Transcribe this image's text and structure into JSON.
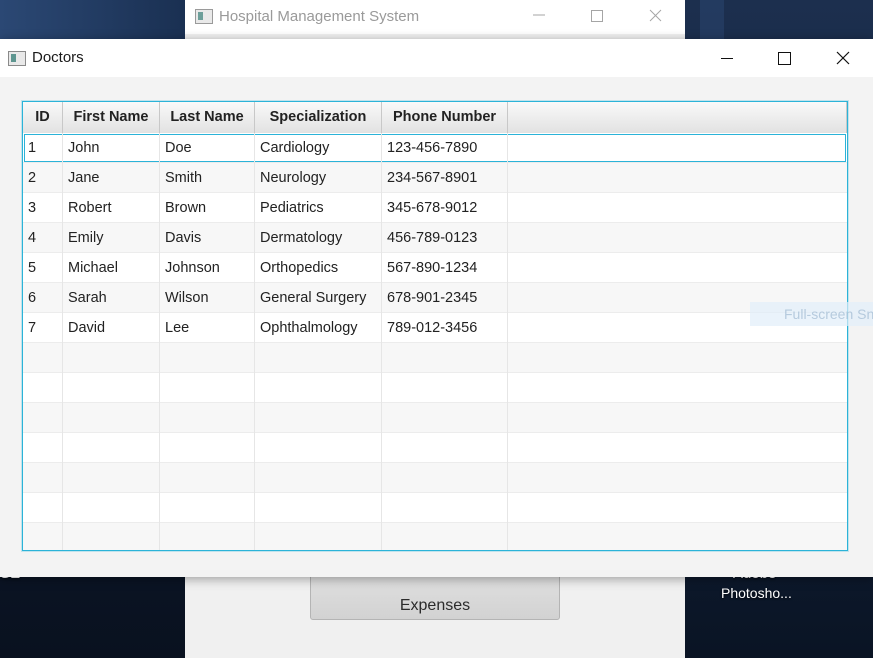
{
  "desktop": {
    "left_label": "ISE",
    "right_label_top": "Adobe",
    "right_label_bottom": "Photosho..."
  },
  "main_window": {
    "title": "Hospital Management System",
    "button_label": "Expenses"
  },
  "dialog": {
    "title": "Doctors",
    "controls": [
      "minimize",
      "maximize",
      "close"
    ]
  },
  "table": {
    "columns": [
      "ID",
      "First Name",
      "Last Name",
      "Specialization",
      "Phone Number"
    ],
    "rows": [
      [
        "1",
        "John",
        "Doe",
        "Cardiology",
        "123-456-7890"
      ],
      [
        "2",
        "Jane",
        "Smith",
        "Neurology",
        "234-567-8901"
      ],
      [
        "3",
        "Robert",
        "Brown",
        "Pediatrics",
        "345-678-9012"
      ],
      [
        "4",
        "Emily",
        "Davis",
        "Dermatology",
        "456-789-0123"
      ],
      [
        "5",
        "Michael",
        "Johnson",
        "Orthopedics",
        "567-890-1234"
      ],
      [
        "6",
        "Sarah",
        "Wilson",
        "General Surgery",
        "678-901-2345"
      ],
      [
        "7",
        "David",
        "Lee",
        "Ophthalmology",
        "789-012-3456"
      ]
    ],
    "empty_rows": 7,
    "selected_row": 0
  },
  "overlay": {
    "toast_text": "Full-screen Sn"
  },
  "colors": {
    "focus": "#2bb3d8",
    "header_bg": "#e6e6e6",
    "stripe": "#f7f7f7"
  }
}
